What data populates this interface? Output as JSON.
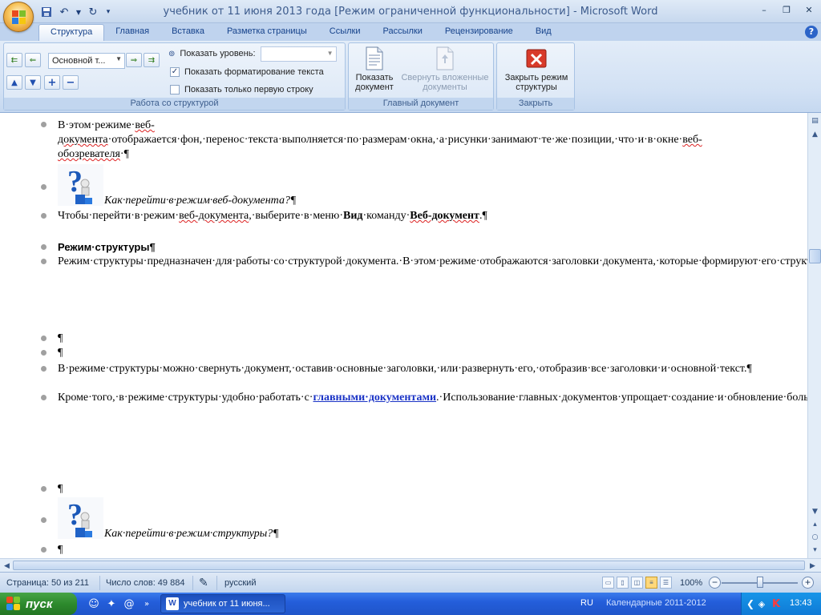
{
  "window": {
    "title": "учебник от 11 июня 2013 года [Режим ограниченной функциональности]  -  Microsoft Word",
    "min": "–",
    "restore": "❐",
    "close": "✕"
  },
  "ribbon": {
    "tabs": [
      "Структура",
      "Главная",
      "Вставка",
      "Разметка страницы",
      "Ссылки",
      "Рассылки",
      "Рецензирование",
      "Вид"
    ],
    "active_tab": "Структура",
    "help": "?",
    "outline_group": {
      "label": "Работа со структурой",
      "level_value": "Основной т...",
      "show_level_label": "Показать уровень:",
      "show_formatting_label": "Показать форматирование текста",
      "show_formatting_checked": true,
      "show_first_line_label": "Показать только первую строку",
      "show_first_line_checked": false
    },
    "master_group": {
      "label": "Главный документ",
      "show_document_label": "Показать документ",
      "collapse_label": "Свернуть вложенные документы"
    },
    "close_group": {
      "label": "Закрыть",
      "close_outline_label": "Закрыть режим структуры"
    }
  },
  "document": {
    "p1": [
      "В·этом·режиме·",
      "веб-документа",
      "·отображается·фон,·перенос·текста·выполняется·по·размерам·окна,·а·рисунки·занимают·те·же·позиции,·что·и·в·окне·",
      "веб-обозревателя",
      "·¶"
    ],
    "p2": "Как·перейти·в·режим·веб-документа?¶",
    "p3": [
      "Чтобы·перейти·в·режим·",
      "веб-документа",
      ",·выберите·в·меню·",
      "Вид",
      "·команду·",
      "Веб-документ",
      ".¶"
    ],
    "p4": "Режим·структуры¶",
    "p5": "Режим·структуры·предназначен·для·работы·со·структурой·документа.·В·этом·режиме·отображаются·заголовки·документа,·которые·формируют·его·структуру.·Этот·режим·позволяет·видеть·структуру·документа,·а·также·перемещать,·копировать·и·реорганизовывать·текст·посредством·перетаскивания·заголовков.¶",
    "empty": "¶",
    "p6": "В·режиме·структуры·можно·свернуть·документ,·оставив·основные·заголовки,·или·развернуть·его,·отобразив·все·заголовки·и·основной·текст.¶",
    "p7": [
      "Кроме·того,·в·режиме·структуры·удобно·работать·с·",
      "главными·документами",
      ".·Использование·главных·документов·упрощает·создание·и·обновление·больших·документов,·таких·как·отчеты,·состоящие·из·нескольких·разделов,·или·книги,·состоящие·из·нескольких·глав.·Границы·страниц,·колонтитулы,·рисунки·и·фон·в·режиме·структуры·не·отображаются.¶"
    ],
    "p8": "Как·перейти·в·режим·структуры?¶"
  },
  "status": {
    "page": "Страница: 50 из 211",
    "words": "Число слов: 49 884",
    "language": "русский",
    "zoom": "100%",
    "zoom_fraction": 0.5
  },
  "taskbar": {
    "start": "пуск",
    "task_word": "учебник от 11 июня...",
    "lang": "RU",
    "calendar": "Календарные 2011-2012",
    "time": "13:43"
  },
  "colors": {
    "link": "#1a33c6",
    "ribbon_text": "#15428b",
    "taskbar": "#245edb",
    "start": "#2d8a2d"
  }
}
